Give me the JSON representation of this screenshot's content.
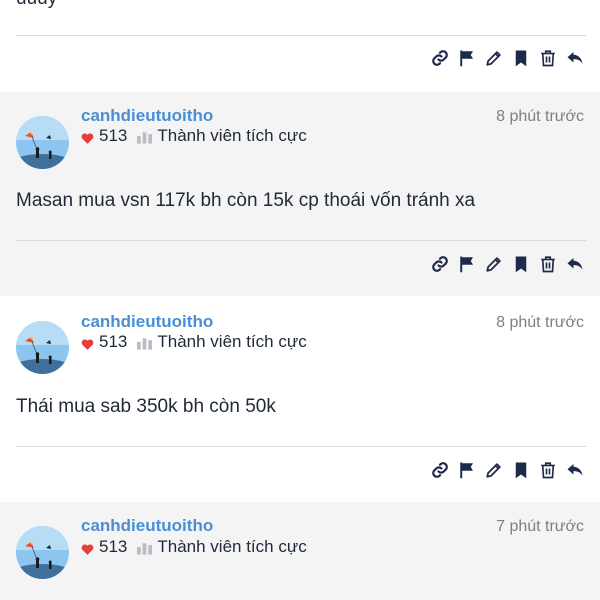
{
  "top_remnant": {
    "text": "uuuy"
  },
  "colors": {
    "username": "#4a8fd6",
    "heart": "#e53e3e",
    "icon": "#1e2a4a",
    "shaded_bg": "#f4f4f5"
  },
  "posts": [
    {
      "username": "canhdieutuoitho",
      "time": "8 phút trước",
      "likes": "513",
      "rank": "Thành viên tích cực",
      "content": "Masan mua vsn 117k bh còn 15k cp thoái vốn tránh xa"
    },
    {
      "username": "canhdieutuoitho",
      "time": "8 phút trước",
      "likes": "513",
      "rank": "Thành viên tích cực",
      "content": "Thái mua sab 350k bh còn 50k"
    },
    {
      "username": "canhdieutuoitho",
      "time": "7 phút trước",
      "likes": "513",
      "rank": "Thành viên tích cực",
      "content": ""
    }
  ],
  "action_icons": [
    "link-icon",
    "flag-icon",
    "pencil-icon",
    "bookmark-icon",
    "trash-icon",
    "reply-icon"
  ]
}
